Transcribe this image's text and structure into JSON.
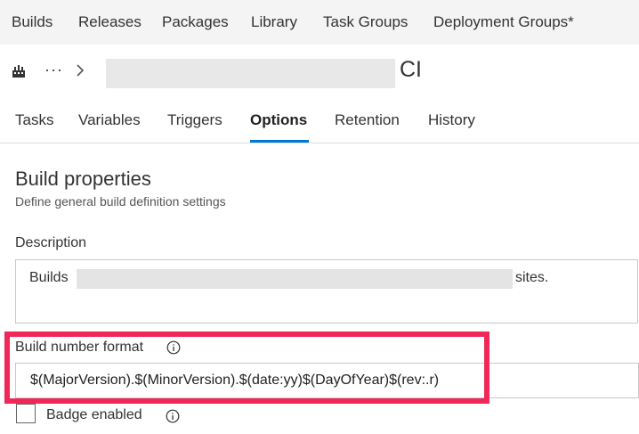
{
  "topnav": {
    "items": [
      "Builds",
      "Releases",
      "Packages",
      "Library",
      "Task Groups",
      "Deployment Groups*"
    ]
  },
  "breadcrumb": {
    "ellipsis": "···",
    "pipeline_suffix": "CI",
    "icons": [
      "pipeline-icon",
      "chevron-right-icon"
    ]
  },
  "tabs": {
    "items": [
      "Tasks",
      "Variables",
      "Triggers",
      "Options",
      "Retention",
      "History"
    ],
    "active": "Options",
    "accent_color": "#0078d4"
  },
  "build_properties": {
    "title": "Build properties",
    "subtitle": "Define general build definition settings"
  },
  "description": {
    "label": "Description",
    "prefix": "Builds",
    "suffix": "sites."
  },
  "build_number_format": {
    "label": "Build number format",
    "value": "$(MajorVersion).$(MinorVersion).$(date:yy)$(DayOfYear)$(rev:.r)",
    "info_icon": "info-icon"
  },
  "badge": {
    "label": "Badge enabled",
    "checked": false
  },
  "annotation": {
    "highlight_color": "#f0285a"
  }
}
